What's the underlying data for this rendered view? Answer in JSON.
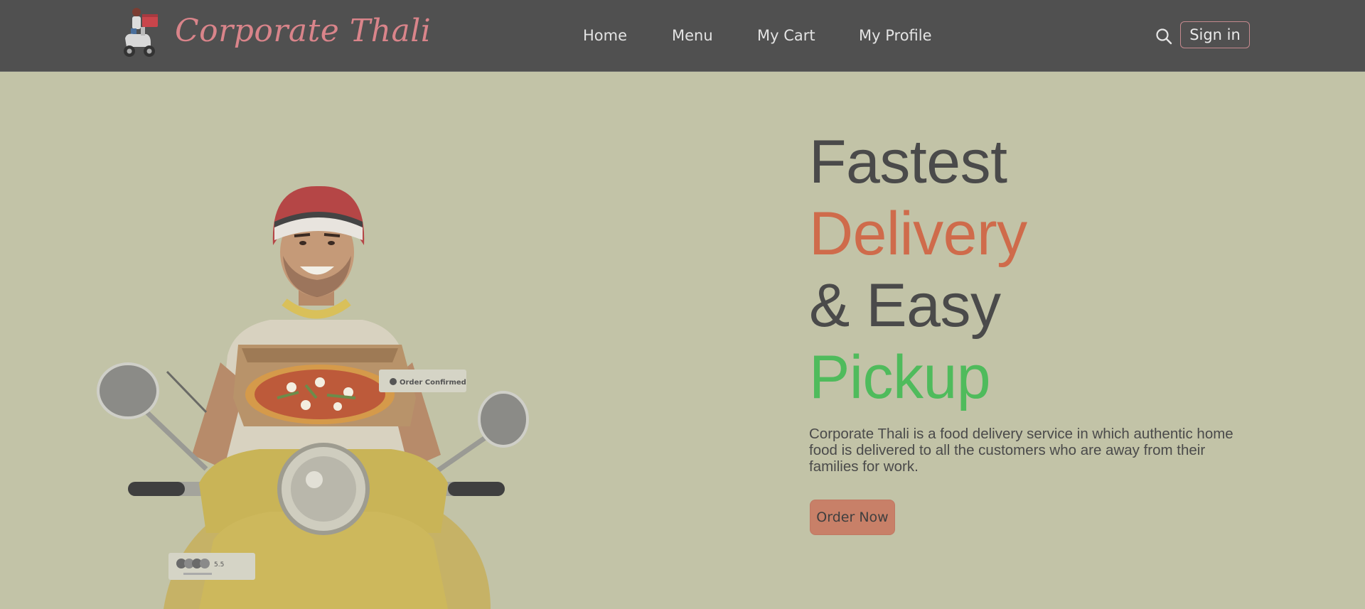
{
  "brand": {
    "name": "Corporate Thali",
    "logo_icon": "delivery-scooter-logo-icon"
  },
  "nav": {
    "items": [
      {
        "label": "Home"
      },
      {
        "label": "Menu"
      },
      {
        "label": "My Cart"
      },
      {
        "label": "My Profile"
      }
    ],
    "search_icon": "search-icon",
    "signin_label": "Sign in"
  },
  "hero": {
    "headline": [
      "Fastest",
      "Delivery",
      "& Easy",
      "Pickup"
    ],
    "description": "Corporate Thali is a food delivery service in which authentic home food is delivered to all the customers who are away from their families for work.",
    "cta_label": "Order Now",
    "illustration": {
      "badge_text": "Order Confirmed",
      "rating_text": "5.5"
    }
  },
  "colors": {
    "header_bg": "#505050",
    "page_bg": "#c2c3a7",
    "brand_pink": "#d9848a",
    "accent_orange": "#cf6b4b",
    "accent_green": "#4fbb5c",
    "button_fill": "#c88068"
  }
}
